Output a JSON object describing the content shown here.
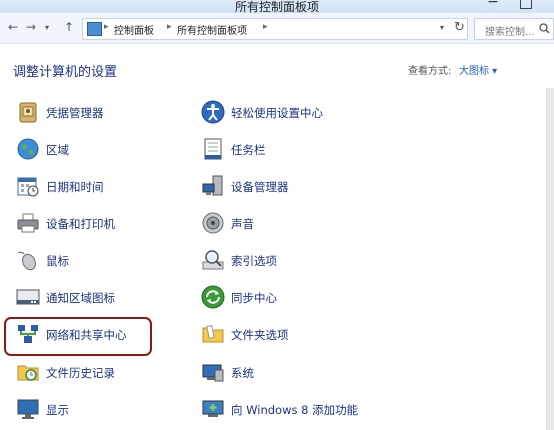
{
  "window": {
    "title": "所有控制面板项",
    "minimize_glyph": "−"
  },
  "nav": {
    "back": "←",
    "forward": "→",
    "dropdown": "▾",
    "up": "↑"
  },
  "address": {
    "crumbs": [
      "控制面板",
      "所有控制面板项"
    ],
    "separator": "▸",
    "dropdown": "▾",
    "refresh": "↻"
  },
  "search": {
    "placeholder": "搜索控制...",
    "icon": "search-icon"
  },
  "main": {
    "heading": "调整计算机的设置",
    "view_label": "查看方式:",
    "view_value": "大图标 ▾"
  },
  "items_left": [
    {
      "label": "凭据管理器",
      "icon": "credential-manager-icon"
    },
    {
      "label": "区域",
      "icon": "globe-icon"
    },
    {
      "label": "日期和时间",
      "icon": "calendar-clock-icon"
    },
    {
      "label": "设备和打印机",
      "icon": "printer-icon"
    },
    {
      "label": "鼠标",
      "icon": "mouse-icon"
    },
    {
      "label": "通知区域图标",
      "icon": "notification-area-icon"
    },
    {
      "label": "网络和共享中心",
      "icon": "network-icon"
    },
    {
      "label": "文件历史记录",
      "icon": "file-history-icon"
    },
    {
      "label": "显示",
      "icon": "display-icon"
    }
  ],
  "items_right": [
    {
      "label": "轻松使用设置中心",
      "icon": "ease-of-access-icon"
    },
    {
      "label": "任务栏",
      "icon": "taskbar-icon"
    },
    {
      "label": "设备管理器",
      "icon": "device-manager-icon"
    },
    {
      "label": "声音",
      "icon": "speaker-icon"
    },
    {
      "label": "索引选项",
      "icon": "index-magnifier-icon"
    },
    {
      "label": "同步中心",
      "icon": "sync-icon"
    },
    {
      "label": "文件夹选项",
      "icon": "folder-options-icon"
    },
    {
      "label": "系统",
      "icon": "system-icon"
    },
    {
      "label": "向 Windows 8 添加功能",
      "icon": "add-features-icon"
    }
  ],
  "colors": {
    "link": "#1e3287",
    "highlight_border": "#8a1a1a",
    "accent": "#1e62b0"
  }
}
